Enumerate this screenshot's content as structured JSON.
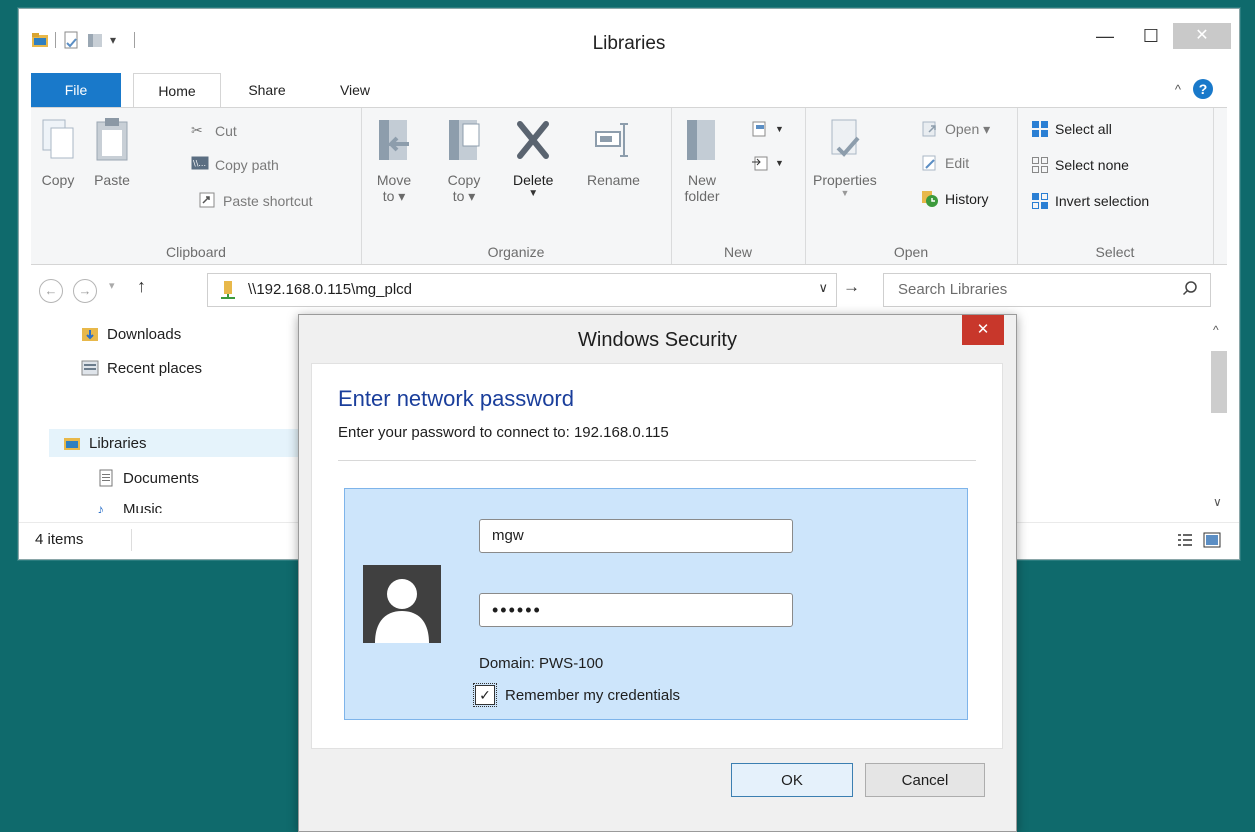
{
  "window": {
    "title": "Libraries",
    "close_glyph": "✕",
    "minimize_glyph": "—",
    "maximize_glyph": "☐"
  },
  "ribbon_tabs": [
    "File",
    "Home",
    "Share",
    "View"
  ],
  "ribbon": {
    "clipboard": {
      "label": "Clipboard",
      "copy": "Copy",
      "paste": "Paste",
      "cut": "Cut",
      "copy_path": "Copy path",
      "paste_shortcut": "Paste shortcut"
    },
    "organize": {
      "label": "Organize",
      "move_to_line1": "Move",
      "move_to_line2": "to ▾",
      "copy_to_line1": "Copy",
      "copy_to_line2": "to ▾",
      "delete": "Delete",
      "rename": "Rename"
    },
    "new": {
      "label": "New",
      "new_folder_line1": "New",
      "new_folder_line2": "folder"
    },
    "open": {
      "label": "Open",
      "properties": "Properties",
      "open": "Open ▾",
      "edit": "Edit",
      "history": "History"
    },
    "select": {
      "label": "Select",
      "select_all": "Select all",
      "select_none": "Select none",
      "invert_selection": "Invert selection"
    }
  },
  "address": {
    "path": "\\\\192.168.0.115\\mg_plcd",
    "search_placeholder": "Search Libraries"
  },
  "nav_pane": {
    "downloads": "Downloads",
    "recent_places": "Recent places",
    "libraries": "Libraries",
    "documents": "Documents",
    "music": "Music"
  },
  "status": {
    "item_count": "4 items"
  },
  "dialog": {
    "title": "Windows Security",
    "heading": "Enter network password",
    "subtitle": "Enter your password to connect to: 192.168.0.115",
    "username": "mgw",
    "password_mask": "••••••",
    "domain": "Domain: PWS-100",
    "remember_label": "Remember my credentials",
    "remember_checked": true,
    "ok_label": "OK",
    "cancel_label": "Cancel"
  },
  "colors": {
    "desktop": "#0f6a6c",
    "file_tab": "#1979ca",
    "dialog_heading": "#1a3e9b",
    "credential_tile": "#cde5fb",
    "dialog_close": "#c8372b"
  }
}
